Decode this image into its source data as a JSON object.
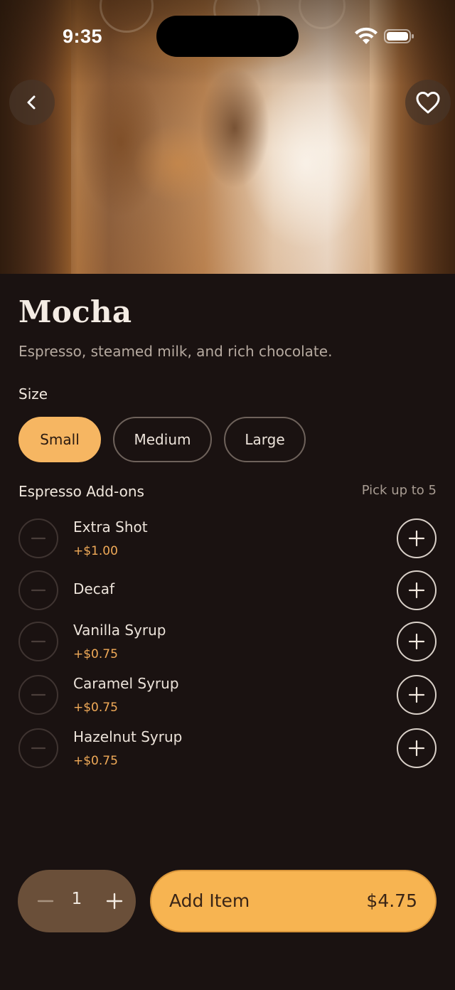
{
  "status_bar": {
    "time": "9:35",
    "icons": [
      "wifi-icon",
      "battery-icon"
    ]
  },
  "hero": {
    "back_icon": "chevron-left-icon",
    "favorite_icon": "heart-icon"
  },
  "product": {
    "title": "Mocha",
    "description": "Espresso, steamed milk, and rich chocolate."
  },
  "size": {
    "label": "Size",
    "options": [
      "Small",
      "Medium",
      "Large"
    ],
    "selected": "Small"
  },
  "addons": {
    "label": "Espresso Add-ons",
    "hint": "Pick up to 5",
    "items": [
      {
        "name": "Extra Shot",
        "price": "+$1.00"
      },
      {
        "name": "Decaf",
        "price": ""
      },
      {
        "name": "Vanilla Syrup",
        "price": "+$0.75"
      },
      {
        "name": "Caramel Syrup",
        "price": "+$0.75"
      },
      {
        "name": "Hazelnut Syrup",
        "price": "+$0.75"
      }
    ]
  },
  "order": {
    "quantity": "1",
    "add_label": "Add Item",
    "total": "$4.75"
  },
  "colors": {
    "background": "#1a1211",
    "accent": "#f6b662",
    "price_text": "#f0aa58",
    "stepper_bg": "#6a4f39"
  }
}
